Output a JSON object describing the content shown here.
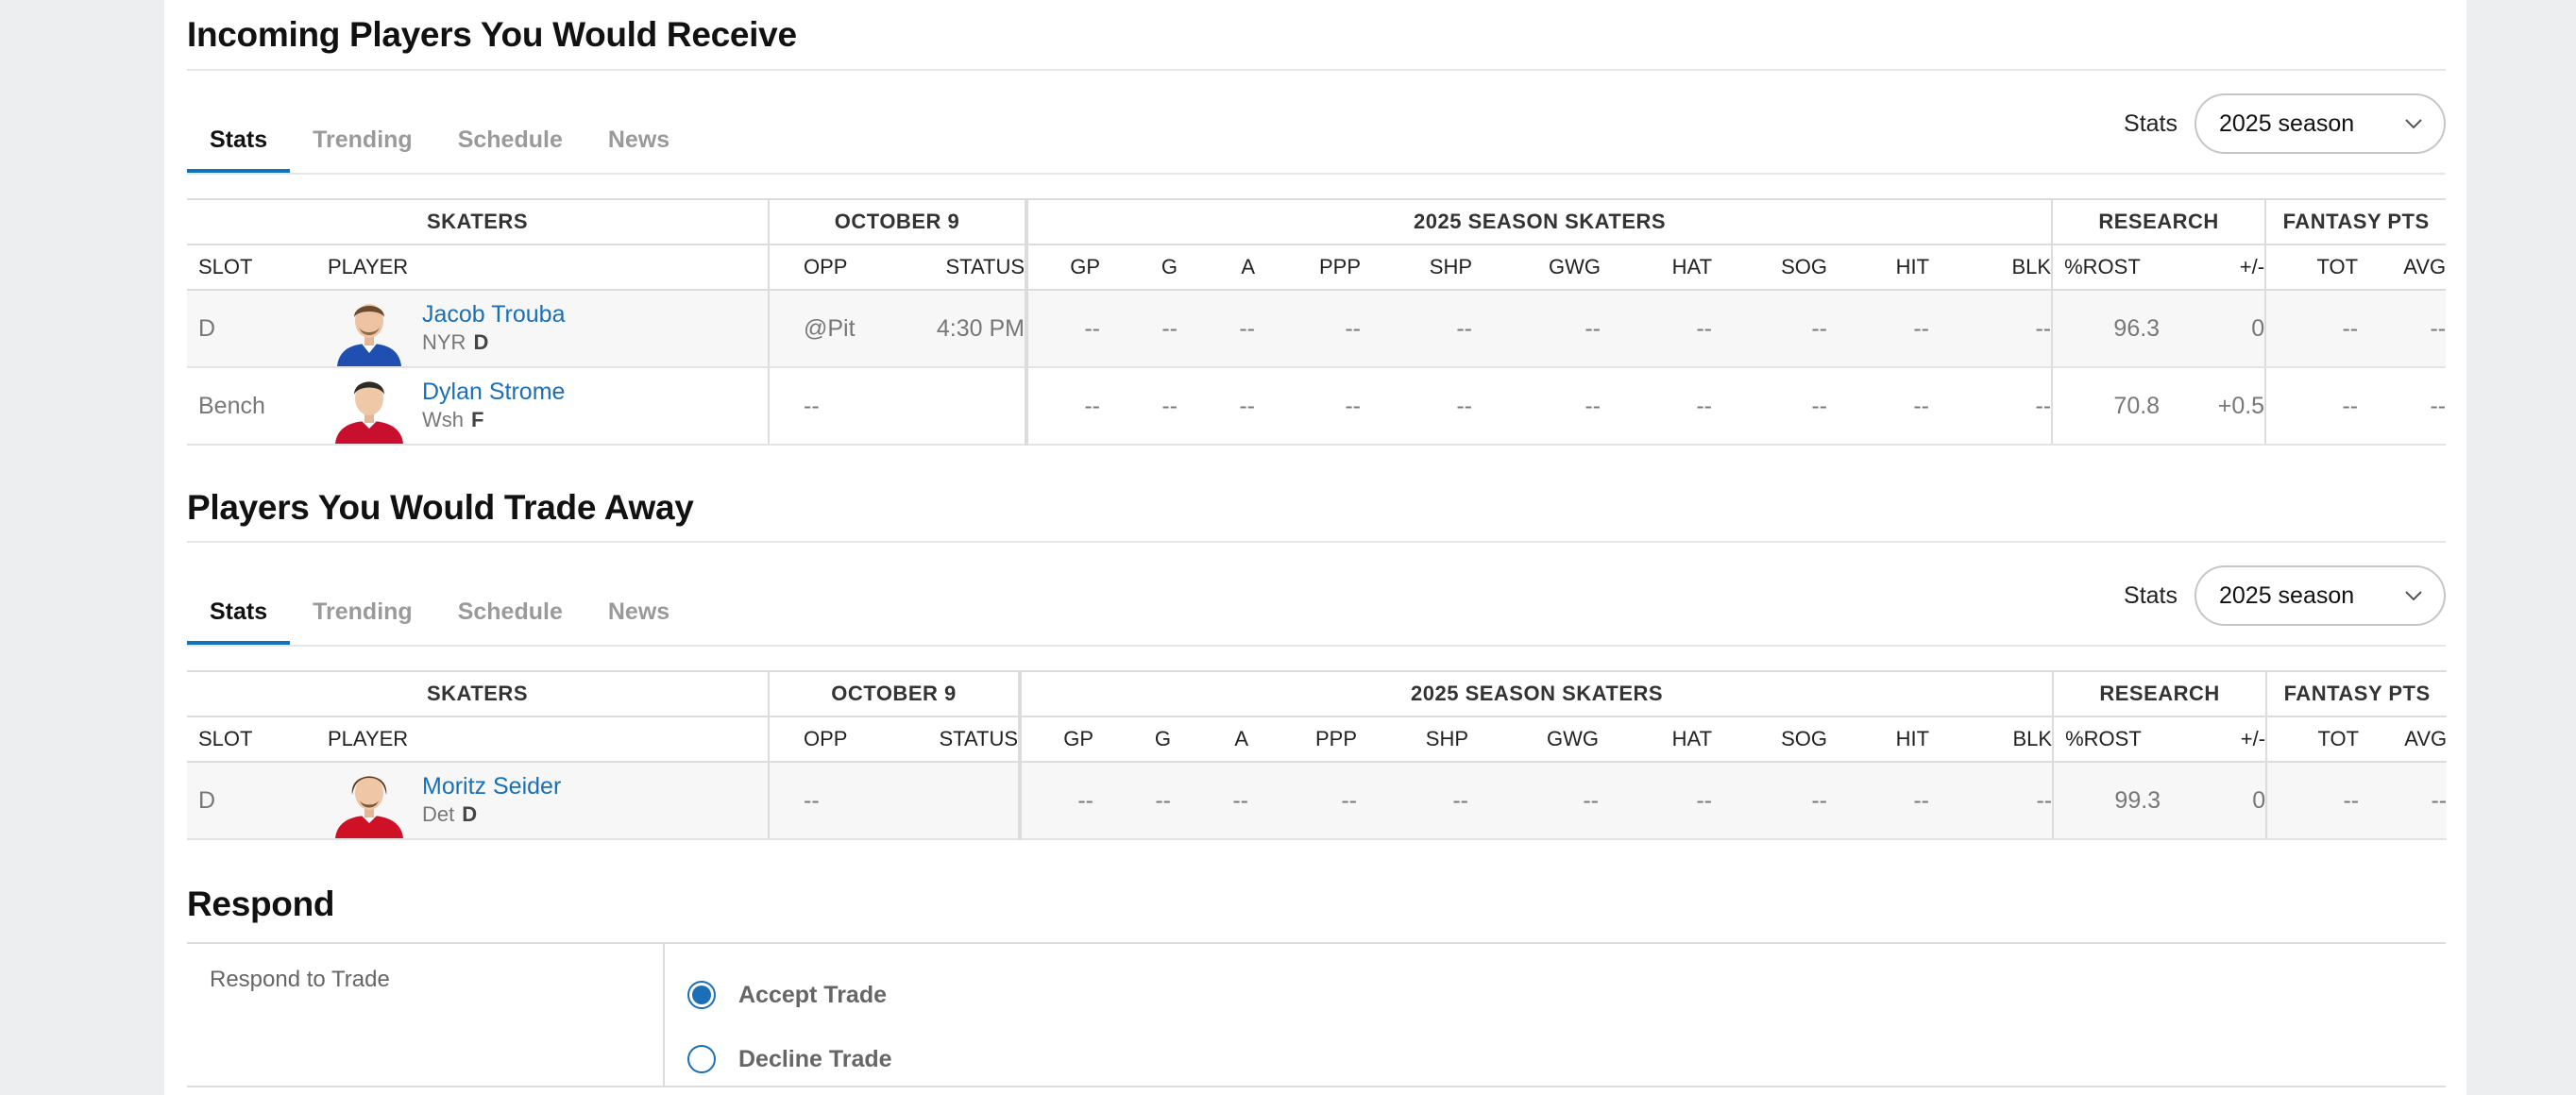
{
  "incoming": {
    "title": "Incoming Players You Would Receive",
    "tabs": [
      "Stats",
      "Trending",
      "Schedule",
      "News"
    ],
    "filter_label": "Stats",
    "filter_value": "2025 season",
    "groups": [
      "SKATERS",
      "OCTOBER 9",
      "2025 SEASON SKATERS",
      "RESEARCH",
      "FANTASY PTS"
    ],
    "columns": [
      "SLOT",
      "PLAYER",
      "OPP",
      "STATUS",
      "GP",
      "G",
      "A",
      "PPP",
      "SHP",
      "GWG",
      "HAT",
      "SOG",
      "HIT",
      "BLK",
      "%ROST",
      "+/-",
      "TOT",
      "AVG"
    ],
    "rows": [
      {
        "slot": "D",
        "name": "Jacob Trouba",
        "team": "NYR",
        "pos": "D",
        "opp": "@Pit",
        "status": "4:30 PM",
        "stats": [
          "--",
          "--",
          "--",
          "--",
          "--",
          "--",
          "--",
          "--",
          "--",
          "--"
        ],
        "rost": "96.3",
        "plusminus": "0",
        "tot": "--",
        "avg": "--"
      },
      {
        "slot": "Bench",
        "name": "Dylan Strome",
        "team": "Wsh",
        "pos": "F",
        "opp": "--",
        "status": "",
        "stats": [
          "--",
          "--",
          "--",
          "--",
          "--",
          "--",
          "--",
          "--",
          "--",
          "--"
        ],
        "rost": "70.8",
        "plusminus": "+0.5",
        "tot": "--",
        "avg": "--"
      }
    ]
  },
  "outgoing": {
    "title": "Players You Would Trade Away",
    "tabs": [
      "Stats",
      "Trending",
      "Schedule",
      "News"
    ],
    "filter_label": "Stats",
    "filter_value": "2025 season",
    "groups": [
      "SKATERS",
      "OCTOBER 9",
      "2025 SEASON SKATERS",
      "RESEARCH",
      "FANTASY PTS"
    ],
    "columns": [
      "SLOT",
      "PLAYER",
      "OPP",
      "STATUS",
      "GP",
      "G",
      "A",
      "PPP",
      "SHP",
      "GWG",
      "HAT",
      "SOG",
      "HIT",
      "BLK",
      "%ROST",
      "+/-",
      "TOT",
      "AVG"
    ],
    "rows": [
      {
        "slot": "D",
        "name": "Moritz Seider",
        "team": "Det",
        "pos": "D",
        "opp": "--",
        "status": "",
        "stats": [
          "--",
          "--",
          "--",
          "--",
          "--",
          "--",
          "--",
          "--",
          "--",
          "--"
        ],
        "rost": "99.3",
        "plusminus": "0",
        "tot": "--",
        "avg": "--"
      }
    ]
  },
  "respond": {
    "title": "Respond",
    "label": "Respond to Trade",
    "options": [
      "Accept Trade",
      "Decline Trade"
    ],
    "selected": 0
  },
  "colors": {
    "accent": "#1173b8",
    "link": "#1a6fb7",
    "positive": "#2a8a3e",
    "jersey_nyr": "#1f4fb0",
    "jersey_wsh": "#c8102e",
    "jersey_det": "#ce1126"
  }
}
